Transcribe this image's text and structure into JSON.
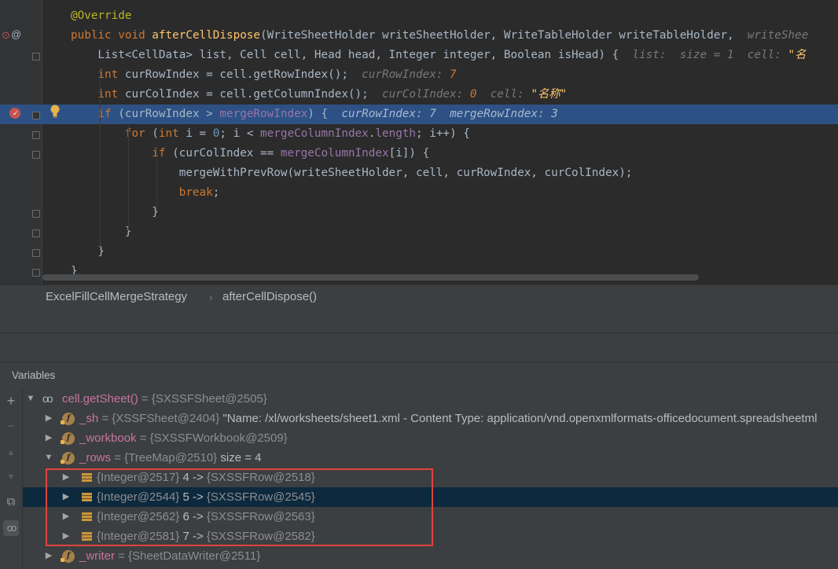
{
  "editor": {
    "lines": [
      {
        "parts": [
          [
            "ann",
            "@Override"
          ]
        ]
      },
      {
        "parts": [
          [
            "kw",
            "public void "
          ],
          [
            "fn",
            "afterCellDispose"
          ],
          [
            "pl",
            "(WriteSheetHolder writeSheetHolder, WriteTableHolder writeTableHolder,  "
          ],
          [
            "hint",
            "writeShee"
          ]
        ]
      },
      {
        "parts": [
          [
            "pl",
            "    List<CellData> list, Cell cell, Head head, Integer integer, Boolean isHead) {  "
          ],
          [
            "hint",
            "list:  size = 1  cell: "
          ],
          [
            "hintstr",
            "\"名"
          ]
        ]
      },
      {
        "parts": [
          [
            "kw",
            "    int "
          ],
          [
            "pl",
            "curRowIndex = cell.getRowIndex();  "
          ],
          [
            "hint",
            "curRowIndex: "
          ],
          [
            "hintv",
            "7"
          ]
        ]
      },
      {
        "parts": [
          [
            "kw",
            "    int "
          ],
          [
            "pl",
            "curColIndex = cell.getColumnIndex();  "
          ],
          [
            "hint",
            "curColIndex: "
          ],
          [
            "hintv",
            "0"
          ],
          [
            "hint",
            "  cell: "
          ],
          [
            "hintstr",
            "\"名称\""
          ]
        ]
      },
      {
        "parts": [
          [
            "kw",
            "    if "
          ],
          [
            "pl",
            "(curRowIndex > "
          ],
          [
            "fld",
            "mergeRowIndex"
          ],
          [
            "pl",
            ") {  "
          ],
          [
            "hint",
            "curRowIndex: 7  mergeRowIndex: 3"
          ]
        ],
        "highlight": true
      },
      {
        "parts": [
          [
            "kw",
            "        for "
          ],
          [
            "pl",
            "("
          ],
          [
            "kw",
            "int "
          ],
          [
            "pl",
            ""
          ],
          [
            "pl",
            "i = "
          ],
          [
            "num",
            "0"
          ],
          [
            "pl",
            "; i < "
          ],
          [
            "fld",
            "mergeColumnIndex"
          ],
          [
            "pl",
            "."
          ],
          [
            "fld",
            "length"
          ],
          [
            "pl",
            "; i++) {"
          ]
        ]
      },
      {
        "parts": [
          [
            "kw",
            "            if "
          ],
          [
            "pl",
            "(curColIndex == "
          ],
          [
            "fld",
            "mergeColumnIndex"
          ],
          [
            "pl",
            "[i]) {"
          ]
        ]
      },
      {
        "parts": [
          [
            "pl",
            "                mergeWithPrevRow(writeSheetHolder, cell, curRowIndex, curColIndex);"
          ]
        ]
      },
      {
        "parts": [
          [
            "kw",
            "                break"
          ],
          [
            "pl",
            ";"
          ]
        ]
      },
      {
        "parts": [
          [
            "pl",
            "            }"
          ]
        ]
      },
      {
        "parts": [
          [
            "pl",
            "        }"
          ]
        ]
      },
      {
        "parts": [
          [
            "pl",
            "    }"
          ]
        ]
      },
      {
        "parts": [
          [
            "pl",
            "}"
          ]
        ]
      }
    ]
  },
  "breadcrumb": {
    "class_name": "ExcelFillCellMergeStrategy",
    "separator": "›",
    "method_name": "afterCellDispose()"
  },
  "variables": {
    "title": "Variables",
    "toolbar": [
      "+",
      "−",
      "▲",
      "▼",
      "⧉",
      "oo"
    ],
    "root": {
      "name": "cell.getSheet()",
      "value": " = {SXSSFSheet@2505}"
    },
    "children": [
      {
        "name": "_sh",
        "type": " = {XSSFSheet@2404} ",
        "extra": "\"Name: /xl/worksheets/sheet1.xml - Content Type: application/vnd.openxmlformats-officedocument.spreadsheetml"
      },
      {
        "name": "_workbook",
        "type": " = {SXSSFWorkbook@2509}",
        "extra": ""
      },
      {
        "name": "_rows",
        "type": " = {TreeMap@2510} ",
        "extra": " size = 4"
      },
      {
        "name": "_writer",
        "type": " = {SheetDataWriter@2511}",
        "extra": ""
      }
    ],
    "entries": [
      {
        "key": "{Integer@2517} ",
        "num": "4",
        "arrow": " -> ",
        "val": "{SXSSFRow@2518}"
      },
      {
        "key": "{Integer@2544} ",
        "num": "5",
        "arrow": " -> ",
        "val": "{SXSSFRow@2545}"
      },
      {
        "key": "{Integer@2562} ",
        "num": "6",
        "arrow": " -> ",
        "val": "{SXSSFRow@2563}"
      },
      {
        "key": "{Integer@2581} ",
        "num": "7",
        "arrow": " -> ",
        "val": "{SXSSFRow@2582}"
      }
    ]
  }
}
